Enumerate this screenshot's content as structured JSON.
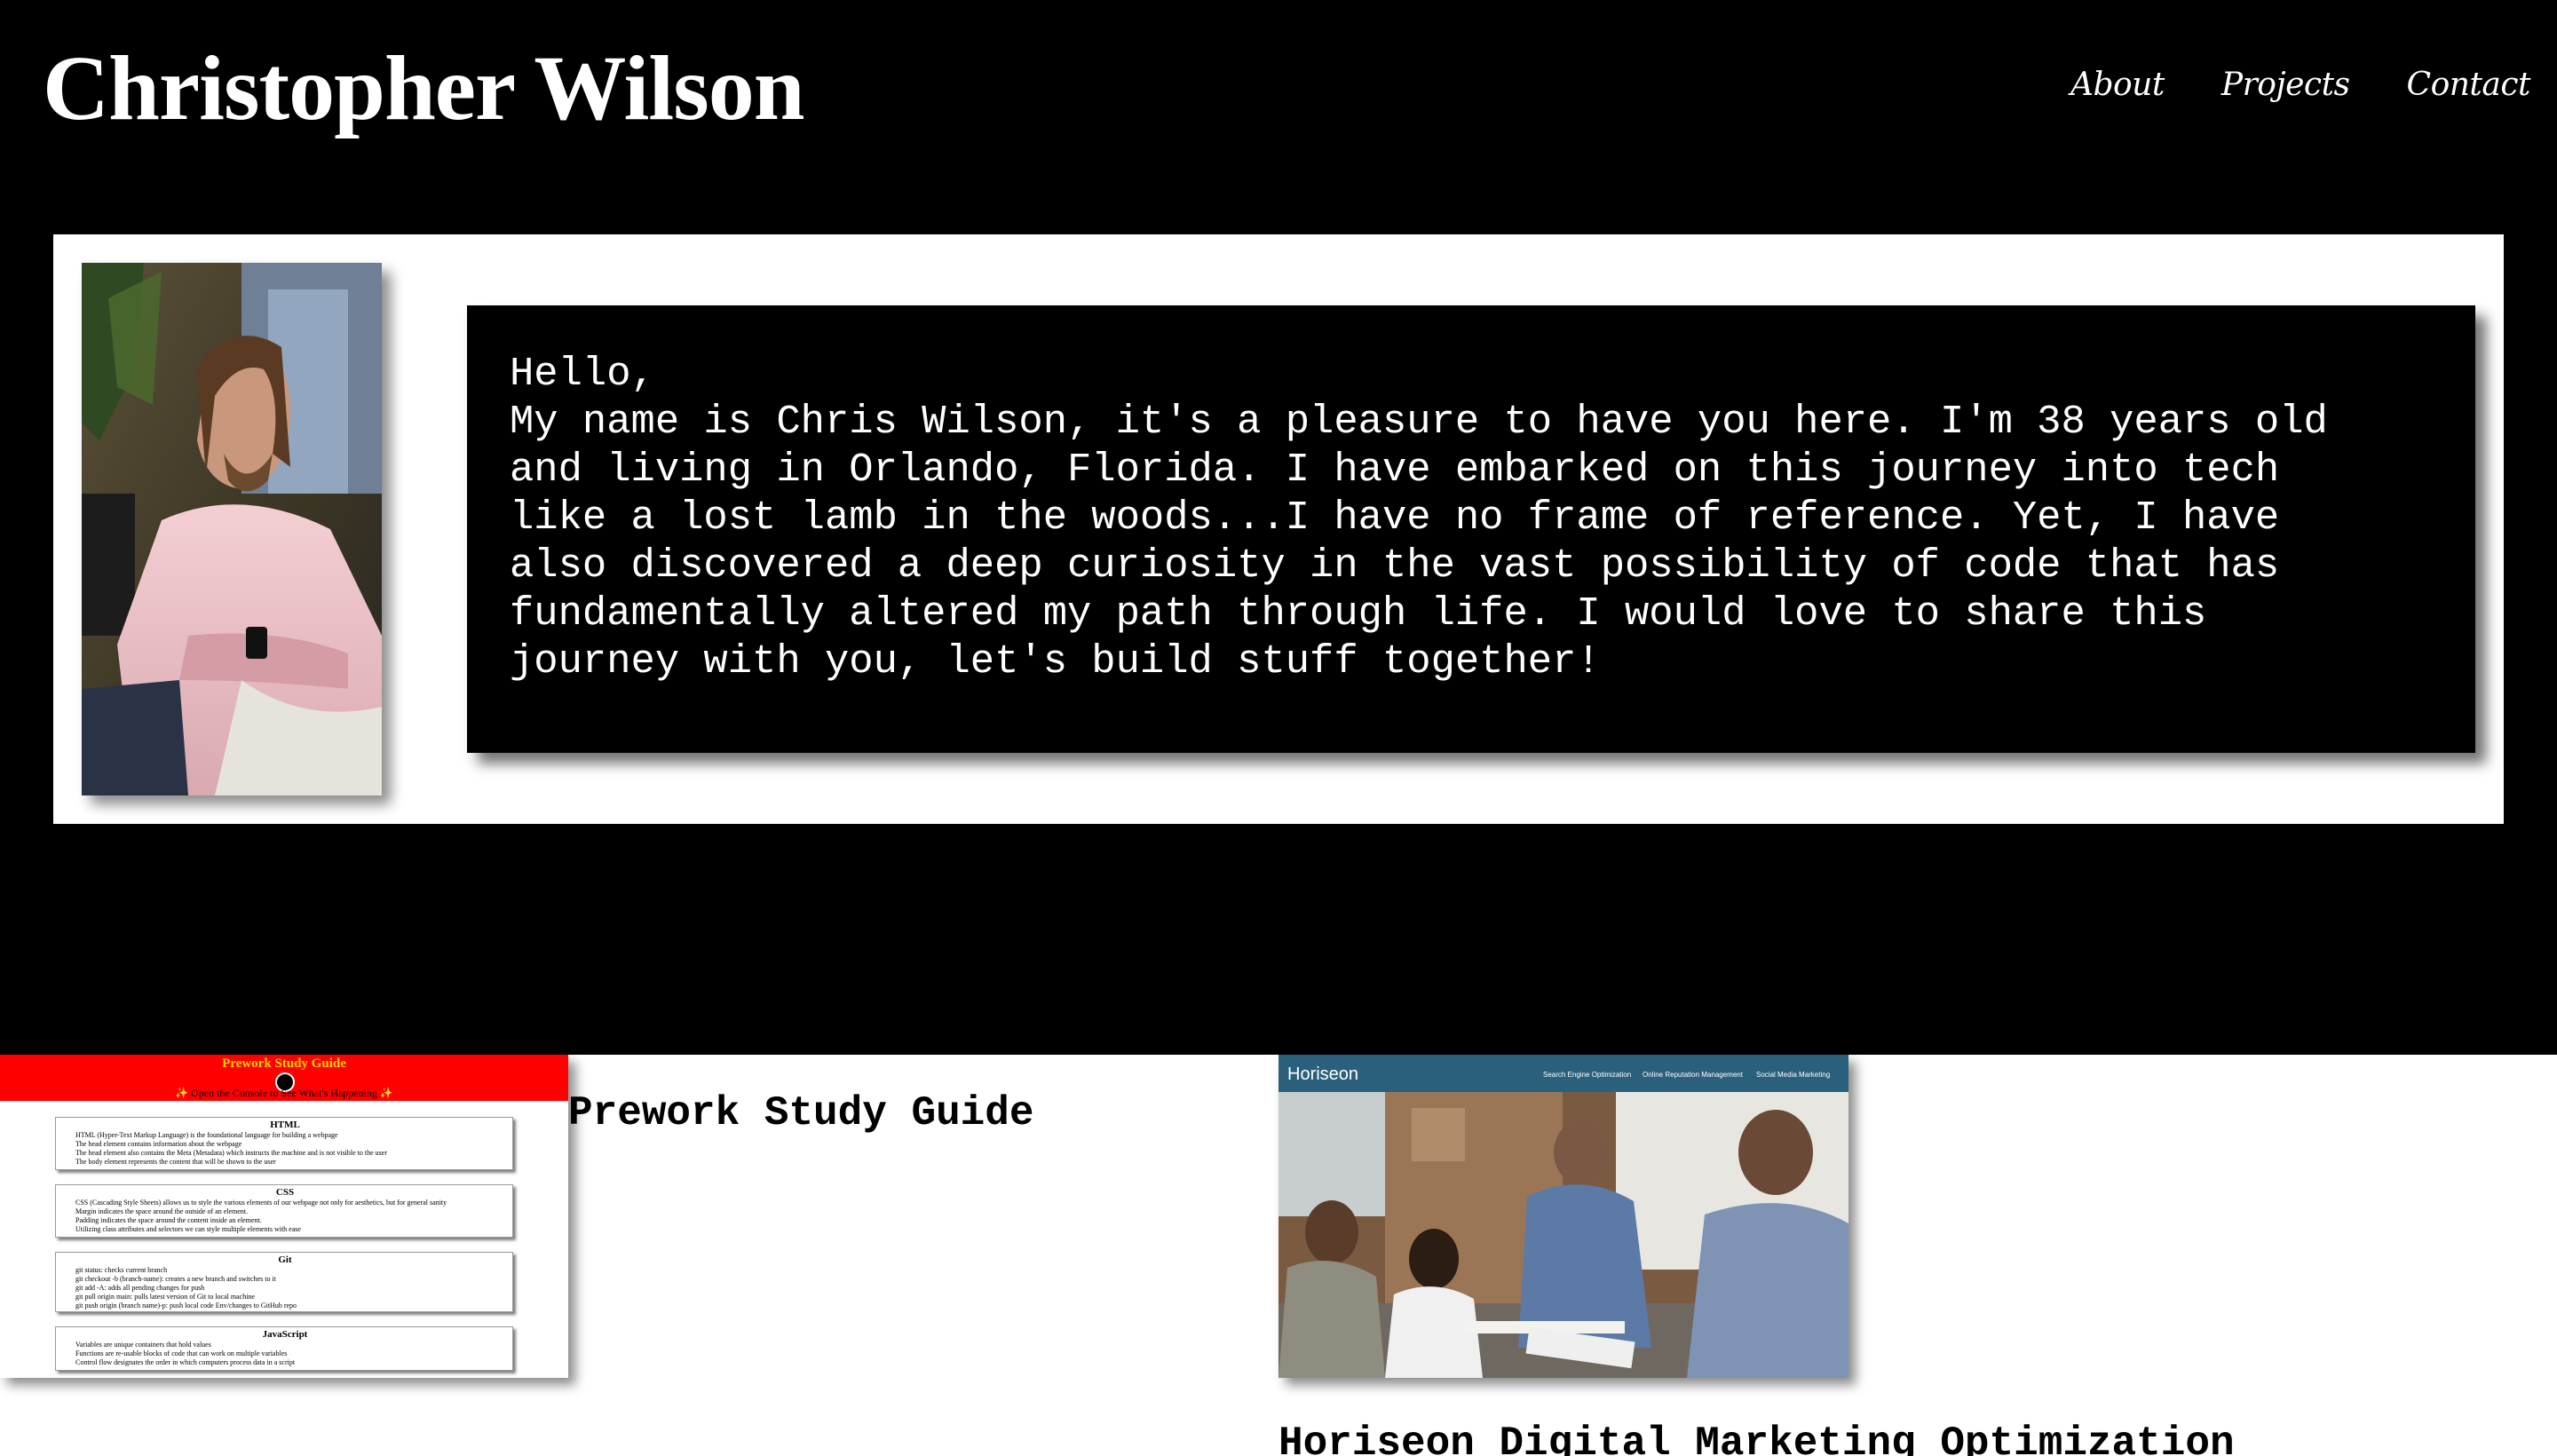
{
  "header": {
    "site_title": "Christopher Wilson",
    "nav": [
      {
        "label": "About"
      },
      {
        "label": "Projects"
      },
      {
        "label": "Contact"
      }
    ]
  },
  "about": {
    "bio": "Hello,\nMy name is Chris Wilson, it's a pleasure to have you here. I'm 38 years old\nand living in Orlando, Florida. I have embarked on this journey into tech\nlike a lost lamb in the woods...I have no frame of reference. Yet, I have\nalso discovered a deep curiosity in the vast possibility of code that has\nfundamentally altered my path through life. I would love to share this\njourney with you, let's build stuff together!"
  },
  "projects": [
    {
      "title": "Prework Study Guide",
      "thumbnail": {
        "title": "Prework Study Guide",
        "subtitle": "✨ Open the Console to See What's Happening ✨",
        "sections": [
          {
            "heading": "HTML",
            "items": [
              "HTML (Hyper-Text Markup Language) is the foundational language for building a webpage",
              "The head element contains information about the webpage",
              "The head element also contains the Meta (Metadata) which instructs the machine and is not visible to the user",
              "The body element represents the content that will be shown to the user"
            ]
          },
          {
            "heading": "CSS",
            "items": [
              "CSS (Cascading Style Sheets) allows us to style the various elements of our webpage not only for aesthetics, but for general sanity",
              "Margin indicates the space around the outside of an element.",
              "Padding indicates the space around the content inside an element.",
              "Utilizing class attributes and selectors we can style multiple elements with ease"
            ]
          },
          {
            "heading": "Git",
            "items": [
              "git status: checks current branch",
              "git checkout -b (branch-name): creates a new branch and switches to it",
              "git add -A: adds all pending changes for push",
              "git pull origin main: pulls latest version of Git to local machine",
              "git push origin (branch name)-p: push local code Env/changes to GitHub repo"
            ]
          },
          {
            "heading": "JavaScript",
            "items": [
              "Variables are unique containers that hold values",
              "Functions are re-usable blocks of code that can work on multiple variables",
              "Control flow designates the order in which computers process data in a script"
            ]
          }
        ]
      }
    },
    {
      "title": "Horiseon Digital Marketing Optimization",
      "thumbnail": {
        "brand": "Horiseon",
        "nav": [
          "Search Engine Optimization",
          "Online Reputation Management",
          "Social Media Marketing"
        ]
      }
    }
  ],
  "colors": {
    "background": "#000000",
    "card": "#ffffff",
    "study_guide_red": "#ff0000",
    "horiseon_header": "#2a607c"
  }
}
